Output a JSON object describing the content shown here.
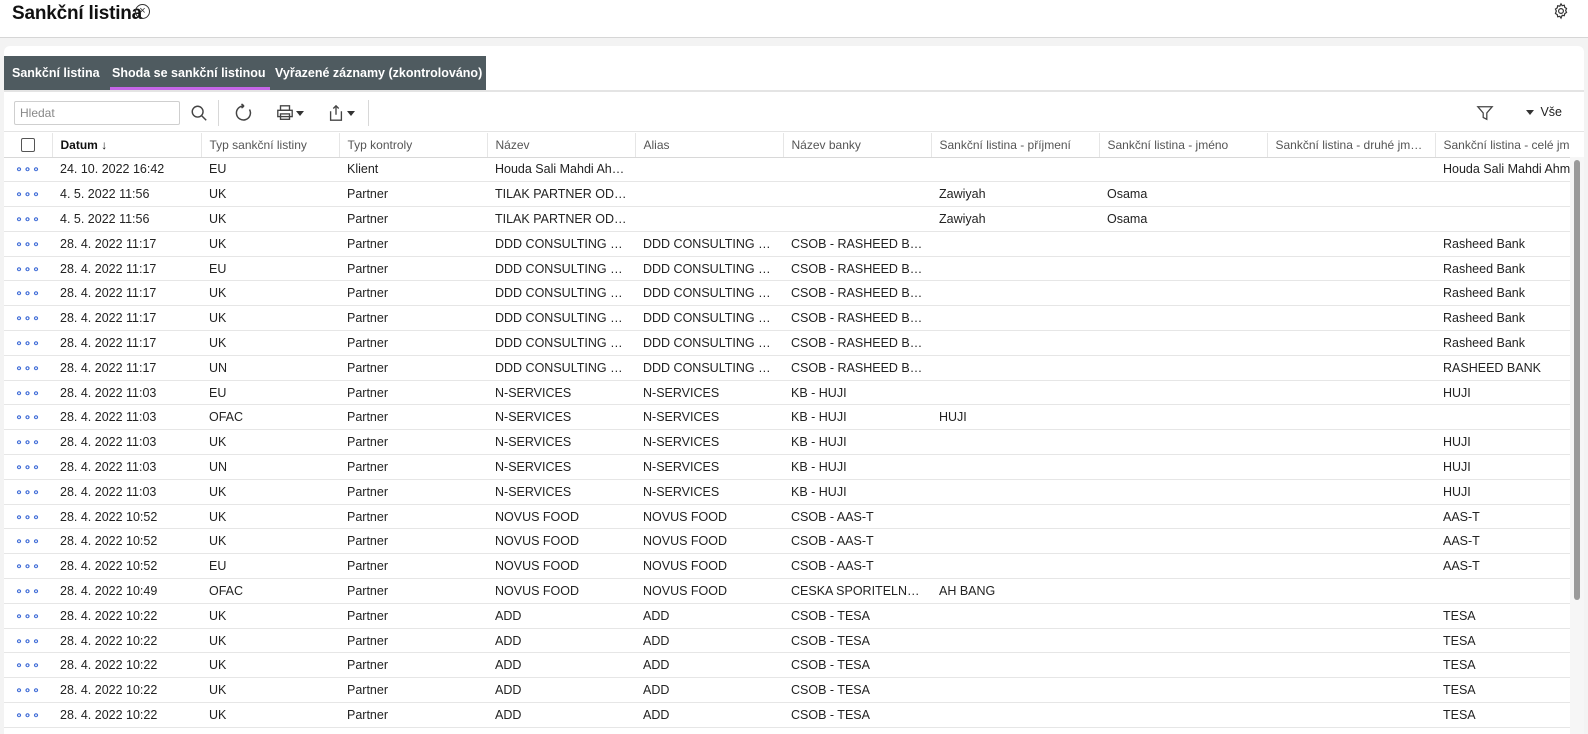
{
  "header": {
    "title": "Sankční listina"
  },
  "tabs": [
    {
      "label": "Sankční listina",
      "active": false
    },
    {
      "label": "Shoda se sankční listinou",
      "active": true
    },
    {
      "label": "Vyřazené záznamy (zkontrolováno)",
      "active": false
    }
  ],
  "toolbar": {
    "search_placeholder": "Hledat",
    "view_label": "Vše"
  },
  "table": {
    "columns": [
      "Datum",
      "Typ sankční listiny",
      "Typ kontroly",
      "Název",
      "Alias",
      "Název banky",
      "Sankční listina - příjmení",
      "Sankční listina - jméno",
      "Sankční listina - druhé jméno",
      "Sankční listina - celé jméno"
    ],
    "sort_indicator": "↓",
    "row_action_glyph": "∘∘∘",
    "rows": [
      [
        "24. 10. 2022 16:42",
        "EU",
        "Klient",
        "Houda Sali Mahdi Ahmed",
        "",
        "",
        "",
        "",
        "",
        "Houda Sali Mahdi Ahmed"
      ],
      [
        "4. 5. 2022 11:56",
        "UK",
        "Partner",
        "TILAK PARTNER ODCHOD",
        "",
        "",
        "Zawiyah",
        "Osama",
        "",
        ""
      ],
      [
        "4. 5. 2022 11:56",
        "UK",
        "Partner",
        "TILAK PARTNER ODCHOD",
        "",
        "",
        "Zawiyah",
        "Osama",
        "",
        ""
      ],
      [
        "28. 4. 2022 11:17",
        "UK",
        "Partner",
        "DDD CONSULTING S.R.O.",
        "DDD CONSULTING S.R.O.",
        "CSOB - RASHEED BANK",
        "",
        "",
        "",
        "Rasheed Bank"
      ],
      [
        "28. 4. 2022 11:17",
        "EU",
        "Partner",
        "DDD CONSULTING S.R.O.",
        "DDD CONSULTING S.R.O.",
        "CSOB - RASHEED BANK",
        "",
        "",
        "",
        "Rasheed Bank"
      ],
      [
        "28. 4. 2022 11:17",
        "UK",
        "Partner",
        "DDD CONSULTING S.R.O.",
        "DDD CONSULTING S.R.O.",
        "CSOB - RASHEED BANK",
        "",
        "",
        "",
        "Rasheed Bank"
      ],
      [
        "28. 4. 2022 11:17",
        "UK",
        "Partner",
        "DDD CONSULTING S.R.O.",
        "DDD CONSULTING S.R.O.",
        "CSOB - RASHEED BANK",
        "",
        "",
        "",
        "Rasheed Bank"
      ],
      [
        "28. 4. 2022 11:17",
        "UK",
        "Partner",
        "DDD CONSULTING S.R.O.",
        "DDD CONSULTING S.R.O.",
        "CSOB - RASHEED BANK",
        "",
        "",
        "",
        "Rasheed Bank"
      ],
      [
        "28. 4. 2022 11:17",
        "UN",
        "Partner",
        "DDD CONSULTING S.R.O.",
        "DDD CONSULTING S.R.O.",
        "CSOB - RASHEED BANK",
        "",
        "",
        "",
        "RASHEED BANK"
      ],
      [
        "28. 4. 2022 11:03",
        "EU",
        "Partner",
        "N-SERVICES",
        "N-SERVICES",
        "KB - HUJI",
        "",
        "",
        "",
        "HUJI"
      ],
      [
        "28. 4. 2022 11:03",
        "OFAC",
        "Partner",
        "N-SERVICES",
        "N-SERVICES",
        "KB - HUJI",
        "HUJI",
        "",
        "",
        ""
      ],
      [
        "28. 4. 2022 11:03",
        "UK",
        "Partner",
        "N-SERVICES",
        "N-SERVICES",
        "KB - HUJI",
        "",
        "",
        "",
        "HUJI"
      ],
      [
        "28. 4. 2022 11:03",
        "UN",
        "Partner",
        "N-SERVICES",
        "N-SERVICES",
        "KB - HUJI",
        "",
        "",
        "",
        "HUJI"
      ],
      [
        "28. 4. 2022 11:03",
        "UK",
        "Partner",
        "N-SERVICES",
        "N-SERVICES",
        "KB - HUJI",
        "",
        "",
        "",
        "HUJI"
      ],
      [
        "28. 4. 2022 10:52",
        "UK",
        "Partner",
        "NOVUS FOOD",
        "NOVUS FOOD",
        "CSOB - AAS-T",
        "",
        "",
        "",
        "AAS-T"
      ],
      [
        "28. 4. 2022 10:52",
        "UK",
        "Partner",
        "NOVUS FOOD",
        "NOVUS FOOD",
        "CSOB - AAS-T",
        "",
        "",
        "",
        "AAS-T"
      ],
      [
        "28. 4. 2022 10:52",
        "EU",
        "Partner",
        "NOVUS FOOD",
        "NOVUS FOOD",
        "CSOB - AAS-T",
        "",
        "",
        "",
        "AAS-T"
      ],
      [
        "28. 4. 2022 10:49",
        "OFAC",
        "Partner",
        "NOVUS FOOD",
        "NOVUS FOOD",
        "CESKA SPORITELNA - AH BANG",
        "AH BANG",
        "",
        "",
        ""
      ],
      [
        "28. 4. 2022 10:22",
        "UK",
        "Partner",
        "ADD",
        "ADD",
        "CSOB - TESA",
        "",
        "",
        "",
        "TESA"
      ],
      [
        "28. 4. 2022 10:22",
        "UK",
        "Partner",
        "ADD",
        "ADD",
        "CSOB - TESA",
        "",
        "",
        "",
        "TESA"
      ],
      [
        "28. 4. 2022 10:22",
        "UK",
        "Partner",
        "ADD",
        "ADD",
        "CSOB - TESA",
        "",
        "",
        "",
        "TESA"
      ],
      [
        "28. 4. 2022 10:22",
        "UK",
        "Partner",
        "ADD",
        "ADD",
        "CSOB - TESA",
        "",
        "",
        "",
        "TESA"
      ],
      [
        "28. 4. 2022 10:22",
        "UK",
        "Partner",
        "ADD",
        "ADD",
        "CSOB - TESA",
        "",
        "",
        "",
        "TESA"
      ]
    ]
  },
  "icons": [
    "close-circle-icon",
    "gear-icon",
    "search-icon",
    "refresh-icon",
    "print-icon",
    "export-icon",
    "filter-icon",
    "column-settings-icon",
    "row-menu-icon"
  ]
}
